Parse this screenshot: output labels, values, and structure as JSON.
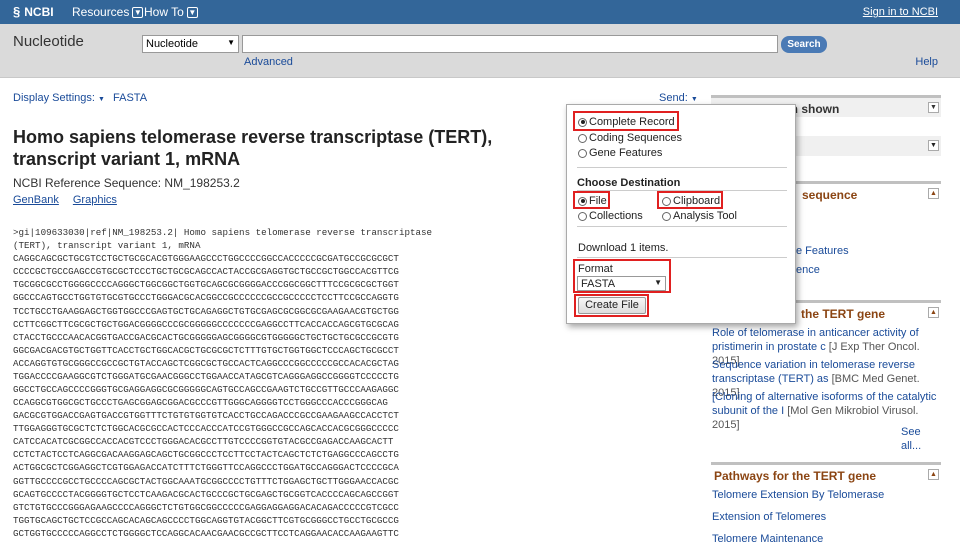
{
  "topbar": {
    "logo": "NCBI",
    "resources": "Resources",
    "howto": "How To",
    "signin": "Sign in to NCBI"
  },
  "search": {
    "db_title": "Nucleotide",
    "db_selected": "Nucleotide",
    "search_button": "Search",
    "advanced": "Advanced",
    "help": "Help",
    "term_value": ""
  },
  "toolbar": {
    "display_settings": "Display Settings:",
    "display_format": "FASTA",
    "send": "Send:"
  },
  "record": {
    "title": "Homo sapiens telomerase reverse transcriptase (TERT), transcript variant 1, mRNA",
    "refseq": "NCBI Reference Sequence: NM_198253.2",
    "links": [
      "GenBank",
      "Graphics"
    ],
    "sequence": [
      ">gi|109633030|ref|NM_198253.2| Homo sapiens telomerase reverse transcriptase",
      "(TERT), transcript variant 1, mRNA",
      "CAGGCAGCGCTGCGTCCTGCTGCGCACGTGGGAAGCCCTGGCCCCGGCCACCCCCGCGATGCCGCGCGCT",
      "CCCCGCTGCCGAGCCGTGCGCTCCCTGCTGCGCAGCCACTACCGCGAGGTGCTGCCGCTGGCCACGTTCG",
      "TGCGGCGCCTGGGGCCCCAGGGCTGGCGGCTGGTGCAGCGCGGGGACCCGGCGGCTTTCCGCGCGCTGGT",
      "GGCCCAGTGCCTGGTGTGCGTGCCCTGGGACGCACGGCCGCCCCCCGCCGCCCCCTCCTTCCGCCAGGTG",
      "TCCTGCCTGAAGGAGCTGGTGGCCCGAGTGCTGCAGAGGCTGTGCGAGCGCGGCGCGAAGAACGTGCTGG",
      "CCTTCGGCTTCGCGCTGCTGGACGGGGCCCGCGGGGGCCCCCCCGAGGCCTTCACCACCAGCGTGCGCAG",
      "CTACCTGCCCAACACGGTGACCGACGCACTGCGGGGGAGCGGGGCGTGGGGGCTGCTGCTGCGCCGCGTG",
      "GGCGACGACGTGCTGGTTCACCTGCTGGCACGCTGCGCGCTCTTTGTGCTGGTGGCTCCCAGCTGCGCCT",
      "ACCAGGTGTGCGGGCCGCCGCTGTACCAGCTCGGCGCTGCCACTCAGGCCCGGCCCCCGCCACACGCTAG",
      "TGGACCCCGAAGGCGTCTGGGATGCGAACGGGCCTGGAACCATAGCGTCAGGGAGGCCGGGGTCCCCCTG",
      "GGCCTGCCAGCCCCGGGTGCGAGGAGGCGCGGGGGCAGTGCCAGCCGAAGTCTGCCGTTGCCCAAGAGGC",
      "CCAGGCGTGGCGCTGCCCTGAGCGGAGCGGACGCCCGTTGGGCAGGGGTCCTGGGCCCACCCGGGCAG",
      "GACGCGTGGACCGAGTGACCGTGGTTTCTGTGTGGTGTCACCTGCCAGACCCGCCGAAGAAGCCACCTCT",
      "TTGGAGGGTGCGCTCTCTGGCACGCGCCACTCCCACCCATCCGTGGGCCGCCAGCACCACGCGGGCCCCC",
      "CATCCACATCGCGGCCACCACGTCCCTGGGACACGCCTTGTCCCCGGTGTACGCCGAGACCAAGCACTT",
      "CCTCTACTCCTCAGGCGACAAGGAGCAGCTGCGGCCCTCCTTCCTACTCAGCTCTCTGAGGCCCAGCCTG",
      "ACTGGCGCTCGGAGGCTCGTGGAGACCATCTTTCTGGGTTCCAGGCCCTGGATGCCAGGGACTCCCCGCA",
      "GGTTGCCCCGCCTGCCCCAGCGCTACTGGCAAATGCGGCCCCTGTTTCTGGAGCTGCTTGGGAACCACGC",
      "GCAGTGCCCCTACGGGGTGCTCCTCAAGACGCACTGCCCGCTGCGAGCTGCGGTCACCCCAGCAGCCGGT",
      "GTCTGTGCCCGGGAGAAGCCCCAGGGCTCTGTGGCGGCCCCCGAGGAGGAGGACACAGACCCCCGTCGCC",
      "TGGTGCAGCTGCTCCGCCAGCACAGCAGCCCCTGGCAGGTGTACGGCTTCGTGCGGGCCTGCCTGCGCCG",
      "GCTGGTGCCCCCAGGCCTCTGGGGCTCCAGGCACAACGAACGCCGCTTCCTCAGGAACACCAAGAAGTTC"
    ]
  },
  "sidebar": {
    "change_region": "Change region shown",
    "sequence_header": "sequence",
    "features_link": "e Features",
    "reference_link": "ence",
    "articles_header": "the TERT gene",
    "articles": [
      {
        "title": "Role of telomerase in anticancer activity of pristimerin in prostate c",
        "meta": "[J Exp Ther Oncol. 2015]"
      },
      {
        "title": "Sequence variation in telomerase reverse transcriptase (TERT) as",
        "meta": "[BMC Med Genet. 2015]"
      },
      {
        "title": "[Cloning of alternative isoforms of the catalytic subunit of the I",
        "meta": "[Mol Gen Mikrobiol Virusol. 2015]"
      }
    ],
    "see_all": "See all...",
    "pathways_header": "Pathways for the TERT gene",
    "pathways": [
      "Telomere Extension By Telomerase",
      "Extension of Telomeres",
      "Telomere Maintenance"
    ]
  },
  "send_popup": {
    "options": [
      "Complete Record",
      "Coding Sequences",
      "Gene Features"
    ],
    "destination_header": "Choose Destination",
    "destinations": [
      "File",
      "Clipboard",
      "Collections",
      "Analysis Tool"
    ],
    "download_text": "Download 1 items.",
    "format_label": "Format",
    "format_value": "FASTA",
    "create_button": "Create File"
  },
  "colors": {
    "topbar": "#336699",
    "link": "#1a4b99",
    "highlight": "#e02020",
    "search_button": "#4a7ab5"
  }
}
